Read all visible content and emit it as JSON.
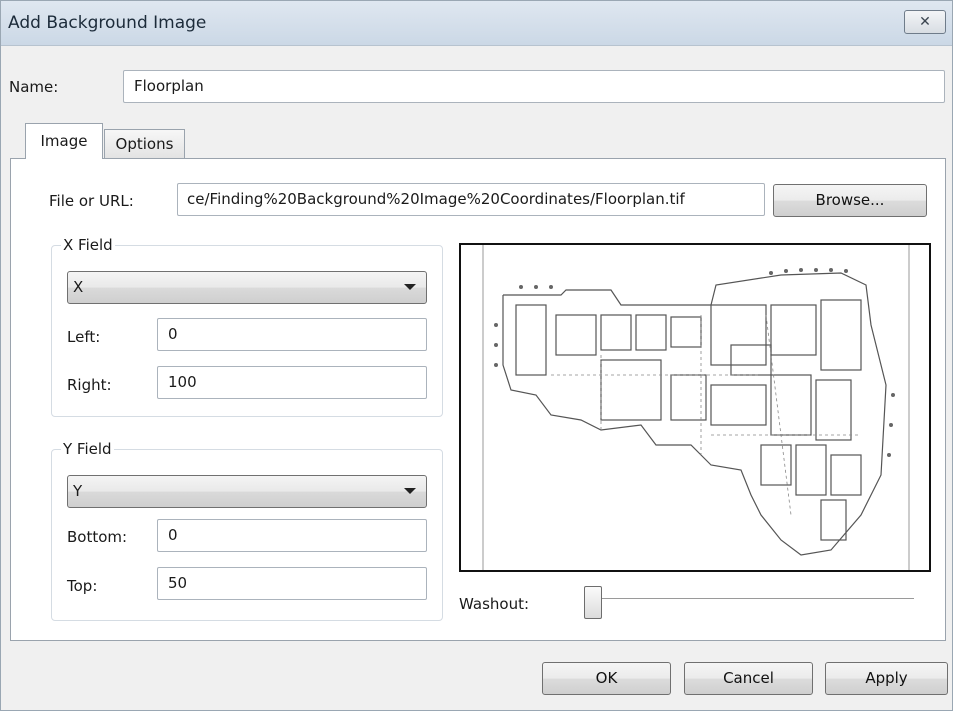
{
  "window": {
    "title": "Add Background Image",
    "close_symbol": "✕"
  },
  "name_row": {
    "label": "Name:",
    "value": "Floorplan"
  },
  "tabs": [
    {
      "label": "Image",
      "selected": true
    },
    {
      "label": "Options",
      "selected": false
    }
  ],
  "file": {
    "label": "File or URL:",
    "value": "ce/Finding%20Background%20Image%20Coordinates/Floorplan.tif",
    "browse_label": "Browse..."
  },
  "x_field": {
    "legend": "X Field",
    "selected": "X",
    "left_label": "Left:",
    "left_value": "0",
    "right_label": "Right:",
    "right_value": "100"
  },
  "y_field": {
    "legend": "Y Field",
    "selected": "Y",
    "bottom_label": "Bottom:",
    "bottom_value": "0",
    "top_label": "Top:",
    "top_value": "50"
  },
  "washout": {
    "label": "Washout:",
    "value": 0
  },
  "buttons": {
    "ok": "OK",
    "cancel": "Cancel",
    "apply": "Apply"
  },
  "preview_icon": "floorplan-image"
}
